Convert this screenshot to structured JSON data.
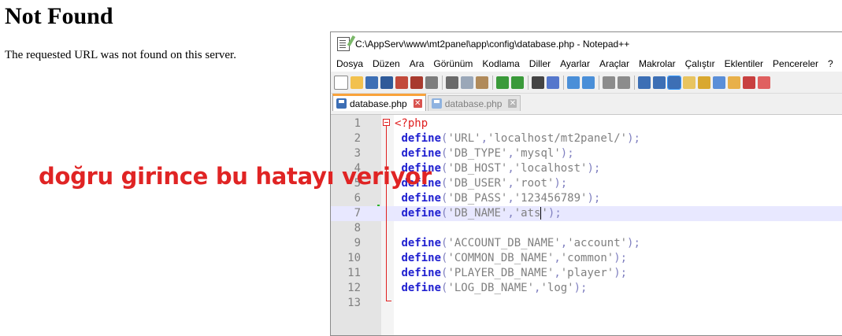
{
  "browser_page": {
    "title": "Not Found",
    "message": "The requested URL was not found on this server."
  },
  "window": {
    "title": "C:\\AppServ\\www\\mt2panel\\app\\config\\database.php - Notepad++"
  },
  "menu": [
    "Dosya",
    "Düzen",
    "Ara",
    "Görünüm",
    "Kodlama",
    "Diller",
    "Ayarlar",
    "Araçlar",
    "Makrolar",
    "Çalıştır",
    "Eklentiler",
    "Pencereler",
    "?"
  ],
  "tabs": [
    {
      "label": "database.php",
      "active": true
    },
    {
      "label": "database.php",
      "active": false
    }
  ],
  "editor": {
    "current_line": 7,
    "lines": [
      {
        "num": "1",
        "tag": "<?php"
      },
      {
        "num": "2",
        "key": "'URL'",
        "value": "'localhost/mt2panel/'"
      },
      {
        "num": "3",
        "key": "'DB_TYPE'",
        "value": "'mysql'"
      },
      {
        "num": "4",
        "key": "'DB_HOST'",
        "value": "'localhost'"
      },
      {
        "num": "5",
        "key": "'DB_USER'",
        "value": "'root'"
      },
      {
        "num": "6",
        "key": "'DB_PASS'",
        "value": "'123456789'"
      },
      {
        "num": "7",
        "key": "'DB_NAME'",
        "value": "'ats'"
      },
      {
        "num": "8"
      },
      {
        "num": "9",
        "key": "'ACCOUNT_DB_NAME'",
        "value": "'account'"
      },
      {
        "num": "10",
        "key": "'COMMON_DB_NAME'",
        "value": "'common'"
      },
      {
        "num": "11",
        "key": "'PLAYER_DB_NAME'",
        "value": "'player'"
      },
      {
        "num": "12",
        "key": "'LOG_DB_NAME'",
        "value": "'log'"
      },
      {
        "num": "13"
      }
    ],
    "keyword": "define"
  },
  "overlay_text": "doğru girince bu hatayı veriyor",
  "colors": {
    "overlay": "#e02424",
    "keyword": "#1f1fd0",
    "string": "#808080",
    "php_tag": "#e02020",
    "active_tab_accent": "#f9a33b",
    "current_line": "#e8e8ff"
  },
  "toolbar_icons": [
    "new-file-icon",
    "open-file-icon",
    "save-icon",
    "save-all-icon",
    "close-icon",
    "close-all-icon",
    "print-icon",
    "cut-icon",
    "copy-icon",
    "paste-icon",
    "undo-icon",
    "redo-icon",
    "find-icon",
    "replace-icon",
    "zoom-in-icon",
    "zoom-out-icon",
    "sync-vertical-icon",
    "sync-horizontal-icon",
    "word-wrap-icon",
    "show-all-chars-icon",
    "indent-guide-icon",
    "user-language-icon",
    "document-map-icon",
    "function-list-icon",
    "folder-workspace-icon",
    "monitoring-icon",
    "macro-record-icon"
  ]
}
